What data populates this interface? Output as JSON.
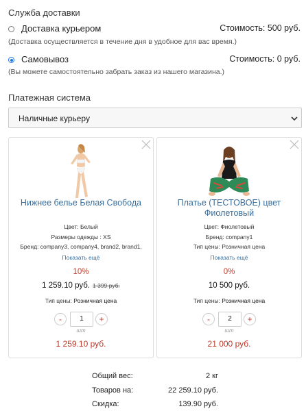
{
  "delivery": {
    "title": "Служба доставки",
    "options": [
      {
        "label": "Доставка курьером",
        "price": "Стоимость: 500 руб.",
        "note": "(Доставка осуществляется в течение дня в удобное для вас время.)",
        "selected": false
      },
      {
        "label": "Самовывоз",
        "price": "Стоимость: 0 руб.",
        "note": "(Вы можете самостоятельно забрать заказ из нашего магазина.)",
        "selected": true
      }
    ]
  },
  "payment": {
    "title": "Платежная система",
    "selected_value": "Наличные курьеру"
  },
  "cart_items": [
    {
      "name": "Нижнее белье Белая Свобода",
      "props": [
        "Цвет: Белый",
        "Размеры одежды : XS",
        "Бренд: company3, company4, brand2, brand1,"
      ],
      "more_link": "Показать ещё",
      "discount": "10%",
      "price": "1 259.10 руб.",
      "old_price": "1 399 руб.",
      "price_type_label": "Тип цены:",
      "price_type_value": "Розничная цена",
      "quantity": "1",
      "unit": "шт",
      "total": "1 259.10 руб.",
      "minus_label": "-",
      "plus_label": "+"
    },
    {
      "name": "Платье (ТЕСТОВОЕ) цвет Фиолетовый",
      "props": [
        "Цвет: Фиолетовый",
        "Бренд: company1",
        "Тип цены: Розничная цена"
      ],
      "more_link": "Показать ещё",
      "discount": "0%",
      "price": "10 500 руб.",
      "old_price": "",
      "price_type_label": "Тип цены:",
      "price_type_value": "Розничная цена",
      "quantity": "2",
      "unit": "шт",
      "total": "21 000 руб.",
      "minus_label": "-",
      "plus_label": "+"
    }
  ],
  "summary": {
    "weight_label": "Общий вес:",
    "weight_value": "2 кг",
    "goods_label": "Товаров на:",
    "goods_value": "22 259.10 руб.",
    "discount_label": "Скидка:",
    "discount_value": "139.90 руб."
  },
  "colors": {
    "link": "#3a6d99",
    "accent_red": "#c0392b",
    "radio_blue": "#1a73e8"
  },
  "icons": {
    "close": "close-icon",
    "chevron": "chevron-down-icon"
  }
}
